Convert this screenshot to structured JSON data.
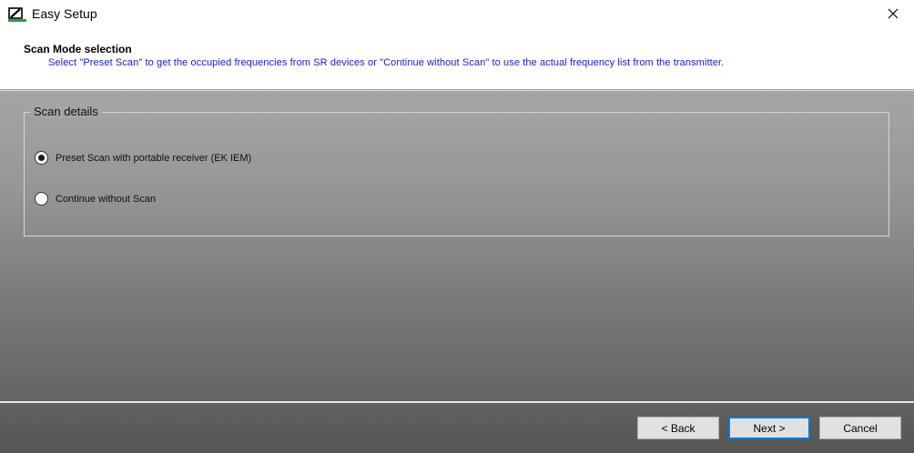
{
  "window": {
    "title": "Easy Setup",
    "icon": "sennheiser-logo-icon",
    "close_icon": "close-icon"
  },
  "header": {
    "title": "Scan Mode selection",
    "description": "Select \"Preset Scan\" to get the occupied frequencies from SR devices or \"Continue without Scan\" to use the actual frequency list from the transmitter."
  },
  "scan_details": {
    "label": "Scan details",
    "options": [
      {
        "label": "Preset Scan with portable receiver (EK IEM)",
        "checked": true
      },
      {
        "label": "Continue without Scan",
        "checked": false
      }
    ]
  },
  "footer": {
    "back_label": "< Back",
    "next_label": "Next >",
    "cancel_label": "Cancel"
  },
  "colors": {
    "description_text": "#1a1acc",
    "default_button_border": "#0078d7"
  }
}
